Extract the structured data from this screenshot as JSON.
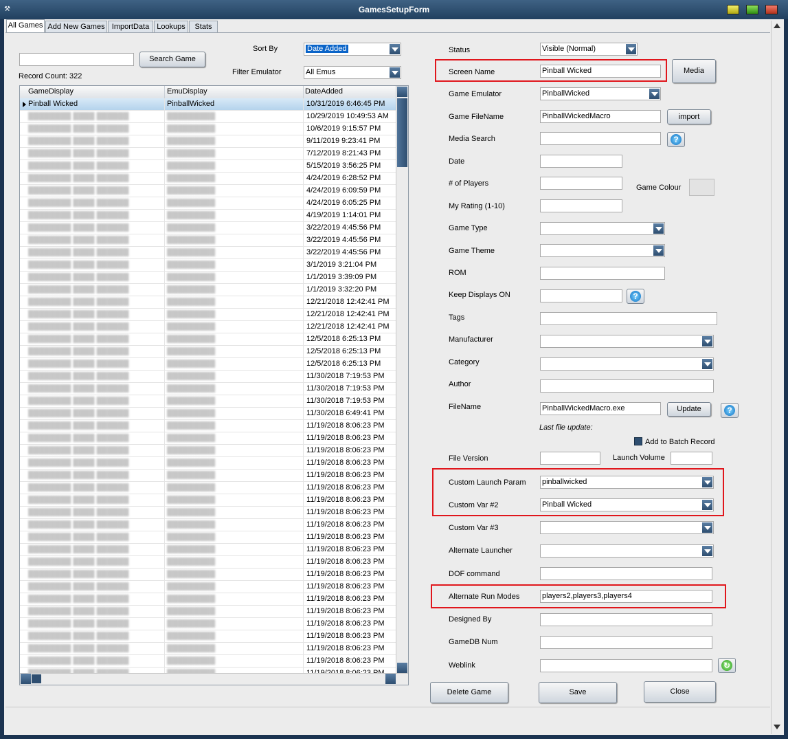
{
  "window": {
    "title": "GamesSetupForm"
  },
  "tabs": [
    "All Games",
    "Add New Games",
    "ImportData",
    "Lookups",
    "Stats"
  ],
  "search": {
    "value": "",
    "button": "Search Game"
  },
  "sort_by": {
    "label": "Sort By",
    "value": "Date Added"
  },
  "filter": {
    "label": "Filter Emulator",
    "value": "All Emus"
  },
  "record_count": "Record Count: 322",
  "grid": {
    "columns": [
      "GameDisplay",
      "EmuDisplay",
      "DateAdded"
    ],
    "selected": {
      "game": "Pinball Wicked",
      "emu": "PinballWicked"
    },
    "dates": [
      "10/31/2019 6:46:45 PM",
      "10/29/2019 10:49:53 AM",
      "10/6/2019 9:15:57 PM",
      "9/11/2019 9:23:41 PM",
      "7/12/2019 8:21:43 PM",
      "5/15/2019 3:56:25 PM",
      "4/24/2019 6:28:52 PM",
      "4/24/2019 6:09:59 PM",
      "4/24/2019 6:05:25 PM",
      "4/19/2019 1:14:01 PM",
      "3/22/2019 4:45:56 PM",
      "3/22/2019 4:45:56 PM",
      "3/22/2019 4:45:56 PM",
      "3/1/2019 3:21:04 PM",
      "1/1/2019 3:39:09 PM",
      "1/1/2019 3:32:20 PM",
      "12/21/2018 12:42:41 PM",
      "12/21/2018 12:42:41 PM",
      "12/21/2018 12:42:41 PM",
      "12/5/2018 6:25:13 PM",
      "12/5/2018 6:25:13 PM",
      "12/5/2018 6:25:13 PM",
      "11/30/2018 7:19:53 PM",
      "11/30/2018 7:19:53 PM",
      "11/30/2018 7:19:53 PM",
      "11/30/2018 6:49:41 PM",
      "11/19/2018 8:06:23 PM",
      "11/19/2018 8:06:23 PM",
      "11/19/2018 8:06:23 PM",
      "11/19/2018 8:06:23 PM",
      "11/19/2018 8:06:23 PM",
      "11/19/2018 8:06:23 PM",
      "11/19/2018 8:06:23 PM",
      "11/19/2018 8:06:23 PM",
      "11/19/2018 8:06:23 PM",
      "11/19/2018 8:06:23 PM",
      "11/19/2018 8:06:23 PM",
      "11/19/2018 8:06:23 PM",
      "11/19/2018 8:06:23 PM",
      "11/19/2018 8:06:23 PM",
      "11/19/2018 8:06:23 PM",
      "11/19/2018 8:06:23 PM",
      "11/19/2018 8:06:23 PM",
      "11/19/2018 8:06:23 PM",
      "11/19/2018 8:06:23 PM",
      "11/19/2018 8:06:23 PM",
      "11/19/2018 8:06:23 PM"
    ]
  },
  "form": {
    "status": {
      "label": "Status",
      "value": "Visible (Normal)"
    },
    "screen_name": {
      "label": "Screen Name",
      "value": "Pinball Wicked"
    },
    "media_button": "Media",
    "game_emulator": {
      "label": "Game Emulator",
      "value": "PinballWicked"
    },
    "game_filename": {
      "label": "Game FileName",
      "value": "PinballWickedMacro"
    },
    "import_button": "import",
    "media_search": {
      "label": "Media Search",
      "value": ""
    },
    "date": {
      "label": "Date",
      "value": ""
    },
    "num_players": {
      "label": "# of  Players",
      "value": ""
    },
    "game_colour": {
      "label": "Game Colour"
    },
    "my_rating": {
      "label": "My Rating (1-10)",
      "value": ""
    },
    "game_type": {
      "label": "Game Type",
      "value": ""
    },
    "game_theme": {
      "label": "Game Theme",
      "value": ""
    },
    "rom": {
      "label": "ROM",
      "value": ""
    },
    "keep_displays": {
      "label": "Keep Displays ON",
      "value": ""
    },
    "tags": {
      "label": "Tags",
      "value": ""
    },
    "manufacturer": {
      "label": "Manufacturer",
      "value": ""
    },
    "category": {
      "label": "Category",
      "value": ""
    },
    "author": {
      "label": "Author",
      "value": ""
    },
    "filename": {
      "label": "FileName",
      "value": "PinballWickedMacro.exe"
    },
    "update_button": "Update",
    "last_file_update": "Last file update:",
    "add_batch": "Add to Batch Record",
    "file_version": {
      "label": "File Version",
      "value": ""
    },
    "launch_volume": {
      "label": "Launch Volume",
      "value": ""
    },
    "custom_launch_param": {
      "label": "Custom Launch Param",
      "value": "pinballwicked"
    },
    "custom_var2": {
      "label": "Custom Var #2",
      "value": "Pinball Wicked"
    },
    "custom_var3": {
      "label": "Custom Var #3",
      "value": ""
    },
    "alternate_launcher": {
      "label": "Alternate Launcher",
      "value": ""
    },
    "dof_command": {
      "label": "DOF command",
      "value": ""
    },
    "alternate_run_modes": {
      "label": "Alternate Run Modes",
      "value": "players2,players3,players4"
    },
    "designed_by": {
      "label": "Designed By",
      "value": ""
    },
    "gamedb_num": {
      "label": "GameDB Num",
      "value": ""
    },
    "weblink": {
      "label": "Weblink",
      "value": ""
    }
  },
  "buttons": {
    "delete": "Delete Game",
    "save": "Save",
    "close": "Close"
  },
  "colors": {
    "highlight": "#e0161c",
    "titlebar": "#2c4a6a",
    "selection": "#0a64c8"
  }
}
